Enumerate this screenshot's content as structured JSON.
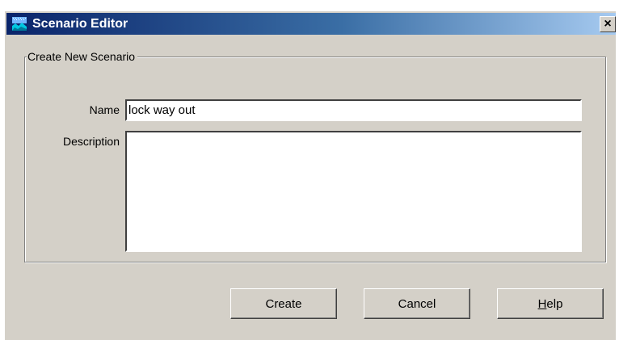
{
  "window": {
    "title": "Scenario Editor",
    "close_glyph": "×",
    "icon": "landscape-app-icon"
  },
  "group": {
    "legend": "Create New Scenario"
  },
  "form": {
    "name_label": "Name",
    "name_value": "lock way out",
    "description_label": "Description",
    "description_value": ""
  },
  "buttons": {
    "create_label": "Create",
    "cancel_label": "Cancel",
    "help_mnemonic": "H",
    "help_rest": "elp"
  },
  "colors": {
    "face": "#d4d0c8",
    "title_start": "#0a246a",
    "title_end": "#a6caf0"
  }
}
